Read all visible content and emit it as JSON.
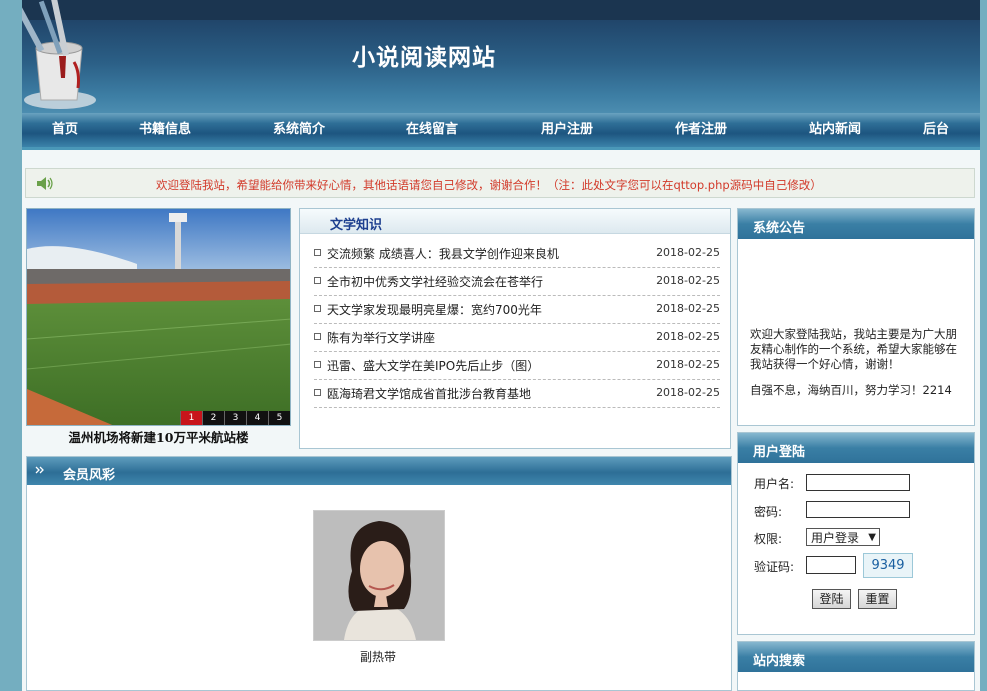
{
  "header": {
    "site_title": "小说阅读网站"
  },
  "nav": {
    "items": [
      {
        "label": "首页"
      },
      {
        "label": "书籍信息"
      },
      {
        "label": "系统简介"
      },
      {
        "label": "在线留言"
      },
      {
        "label": "用户注册"
      },
      {
        "label": "作者注册"
      },
      {
        "label": "站内新闻"
      },
      {
        "label": "后台"
      }
    ]
  },
  "notice": {
    "text": "欢迎登陆我站，希望能给你带来好心情，其他话语请您自己修改，谢谢合作！（注：此处文字您可以在qttop.php源码中自己修改）"
  },
  "photo": {
    "caption": "温州机场将新建10万平米航站楼",
    "slides": [
      "1",
      "2",
      "3",
      "4",
      "5"
    ],
    "active_slide": 1
  },
  "knowledge": {
    "title": "文学知识",
    "items": [
      {
        "title": "交流频繁 成绩喜人：我县文学创作迎来良机",
        "date": "2018-02-25"
      },
      {
        "title": "全市初中优秀文学社经验交流会在苍举行",
        "date": "2018-02-25"
      },
      {
        "title": "天文学家发现最明亮星爆：宽约700光年",
        "date": "2018-02-25"
      },
      {
        "title": "陈有为举行文学讲座",
        "date": "2018-02-25"
      },
      {
        "title": "迅雷、盛大文学在美IPO先后止步（图）",
        "date": "2018-02-25"
      },
      {
        "title": "瓯海琦君文学馆成省首批涉台教育基地",
        "date": "2018-02-25"
      }
    ]
  },
  "member": {
    "title": "会员风彩",
    "name": "副热带"
  },
  "announcement": {
    "title": "系统公告",
    "text": "欢迎大家登陆我站，我站主要是为广大朋友精心制作的一个系统，希望大家能够在我站获得一个好心情，谢谢！",
    "motto": "自强不息，海纳百川，努力学习！2214"
  },
  "login": {
    "title": "用户登陆",
    "username_label": "用户名:",
    "username_value": "",
    "password_label": "密码:",
    "password_value": "",
    "role_label": "权限:",
    "role_value": "用户登录",
    "captcha_label": "验证码:",
    "captcha_value": "",
    "captcha_code": "9349",
    "login_button": "登陆",
    "reset_button": "重置"
  },
  "search": {
    "title": "站内搜索"
  },
  "colors": {
    "accent_blue": "#2d6e96",
    "notice_red": "#d23a2a",
    "knowledge_title": "#1d3f8f",
    "active_slide": "#c8141b"
  }
}
